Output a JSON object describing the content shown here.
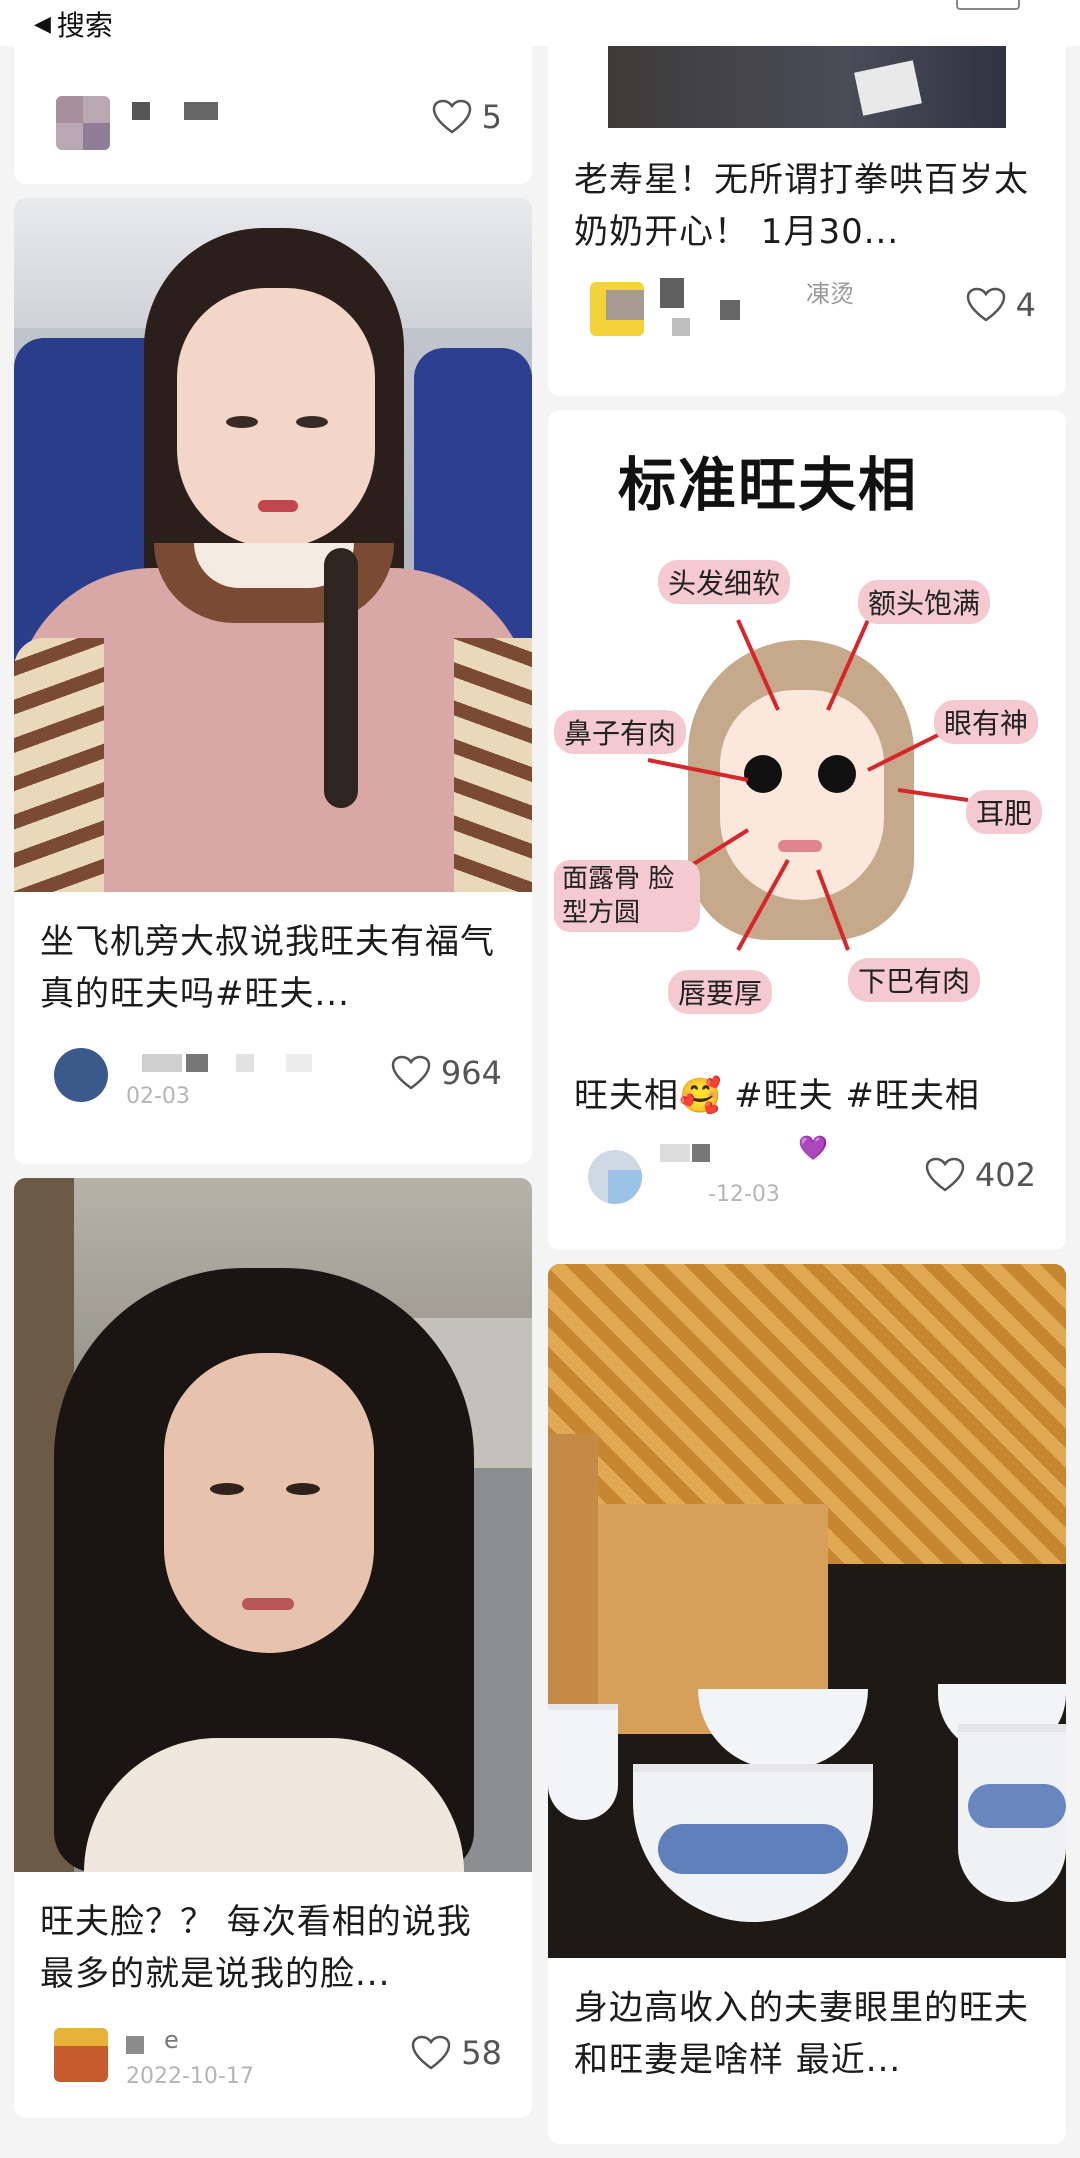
{
  "header": {
    "back_label": "搜索"
  },
  "cards": {
    "c1": {
      "likes": "5"
    },
    "c2": {
      "title": "坐飞机旁大叔说我旺夫有福气 真的旺夫吗#旺夫...",
      "likes": "964",
      "date": "02-03"
    },
    "c3": {
      "title": "旺夫脸？？ 每次看相的说我最多的就是说我的脸...",
      "likes": "58",
      "user": "e",
      "date": "2022-10-17"
    },
    "c4": {
      "title": "老寿星！无所谓打拳哄百岁太奶奶开心！ 1月30...",
      "likes": "4",
      "user": "凍烫"
    },
    "c5": {
      "title": "旺夫相🥰 #旺夫 #旺夫相",
      "likes": "402",
      "user": "💜",
      "date": "-12-03",
      "poster": {
        "heading": "标准旺夫相",
        "labels": [
          "头发细软",
          "额头饱满",
          "眼有神",
          "鼻子有肉",
          "耳肥",
          "面露骨 脸型方圆",
          "唇要厚",
          "下巴有肉"
        ]
      }
    },
    "c6": {
      "title": "身边高收入的夫妻眼里的旺夫和旺妻是啥样 最近..."
    }
  },
  "colors": {
    "accent_red": "#d6262b",
    "like_gray": "#555555",
    "pink_label": "#f4c9cf"
  }
}
